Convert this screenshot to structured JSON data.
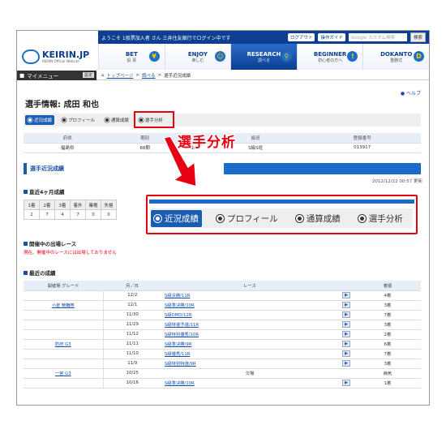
{
  "topbar": {
    "welcome": "ようこそ 1般票加入者 さん 三井住友銀行でログイン中です",
    "logout": "ログアウト",
    "guide": "操作ガイド",
    "search_placeholder": "Google カスタム検索",
    "search_btn": "検索"
  },
  "logo": {
    "text": "KEIRIN.JP",
    "sub": "KEIRIN Official Website"
  },
  "nav": [
    {
      "label": "BET",
      "sub": "投 票",
      "icon": "ticket-icon"
    },
    {
      "label": "ENJOY",
      "sub": "楽しむ",
      "icon": "smile-icon"
    },
    {
      "label": "RESEARCH",
      "sub": "調べる",
      "icon": "search-icon"
    },
    {
      "label": "BEGINNER",
      "sub": "初心者の方へ",
      "icon": "beginner-icon"
    },
    {
      "label": "DOKANTO",
      "sub": "重勝式",
      "icon": "d-icon"
    }
  ],
  "menubar": {
    "mymenu": "マイメニュー",
    "setting": "設定",
    "crumbs": [
      "トップページ",
      "調べる",
      "選手近況成績"
    ]
  },
  "help": "ヘルプ",
  "page_title": "選手情報: 成田 和也",
  "tabs": [
    "近況成績",
    "プロフィール",
    "通算成績",
    "選手分析"
  ],
  "info": {
    "headers": [
      "府県",
      "期別",
      "",
      "級班",
      "登録番号"
    ],
    "values": [
      "福島県",
      "88期",
      "",
      "S級S班",
      "013917"
    ],
    "mid_partial": "上"
  },
  "section_title": "選手近況成績",
  "datestamp": "2012/12/22 00:57 更新",
  "recent_head": "直近4ヶ月成績",
  "recent_table": {
    "headers": [
      "1着",
      "2着",
      "3着",
      "着外",
      "棄権",
      "失格"
    ],
    "values": [
      "2",
      "7",
      "4",
      "7",
      "0",
      "0"
    ]
  },
  "entry_head": "開催中の出場レース",
  "entry_note": "現在、開催中のレースには出場しておりません",
  "results_head": "最近の成績",
  "results_headers": [
    "開催場 グレード",
    "月／日",
    "レース",
    "",
    "着順"
  ],
  "results": [
    {
      "venue": "",
      "date": "12/2",
      "race": "S級決勝/11R",
      "place": "4着"
    },
    {
      "venue": "小倉 競輪祭",
      "date": "12/1",
      "race": "S級準決勝/10R",
      "place": "3着"
    },
    {
      "venue": "",
      "date": "11/30",
      "race": "S級DMD/12R",
      "place": "7着"
    },
    {
      "venue": "",
      "date": "11/29",
      "race": "S級特選予選/11R",
      "place": "3着"
    },
    {
      "venue": "",
      "date": "11/12",
      "race": "S級特別優秀/10R",
      "place": "2着"
    },
    {
      "venue": "防府 G3",
      "date": "11/11",
      "race": "S級準決勝/9R",
      "place": "6着"
    },
    {
      "venue": "",
      "date": "11/10",
      "race": "S級優秀/11R",
      "place": "7着"
    },
    {
      "venue": "",
      "date": "11/9",
      "race": "S級特別特選/9R",
      "place": "3着"
    },
    {
      "venue": "一宮 G3",
      "date": "10/25",
      "race": "欠場",
      "place": "病気"
    },
    {
      "venue": "",
      "date": "10/16",
      "race": "S級準決勝/10R",
      "place": "1着"
    }
  ],
  "overlay": {
    "title": "選手分析",
    "zoom_tabs": [
      "近況成績",
      "プロフィール",
      "通算成績",
      "選手分析"
    ]
  },
  "colors": {
    "accent": "#e60012",
    "brand": "#0d3e91"
  }
}
